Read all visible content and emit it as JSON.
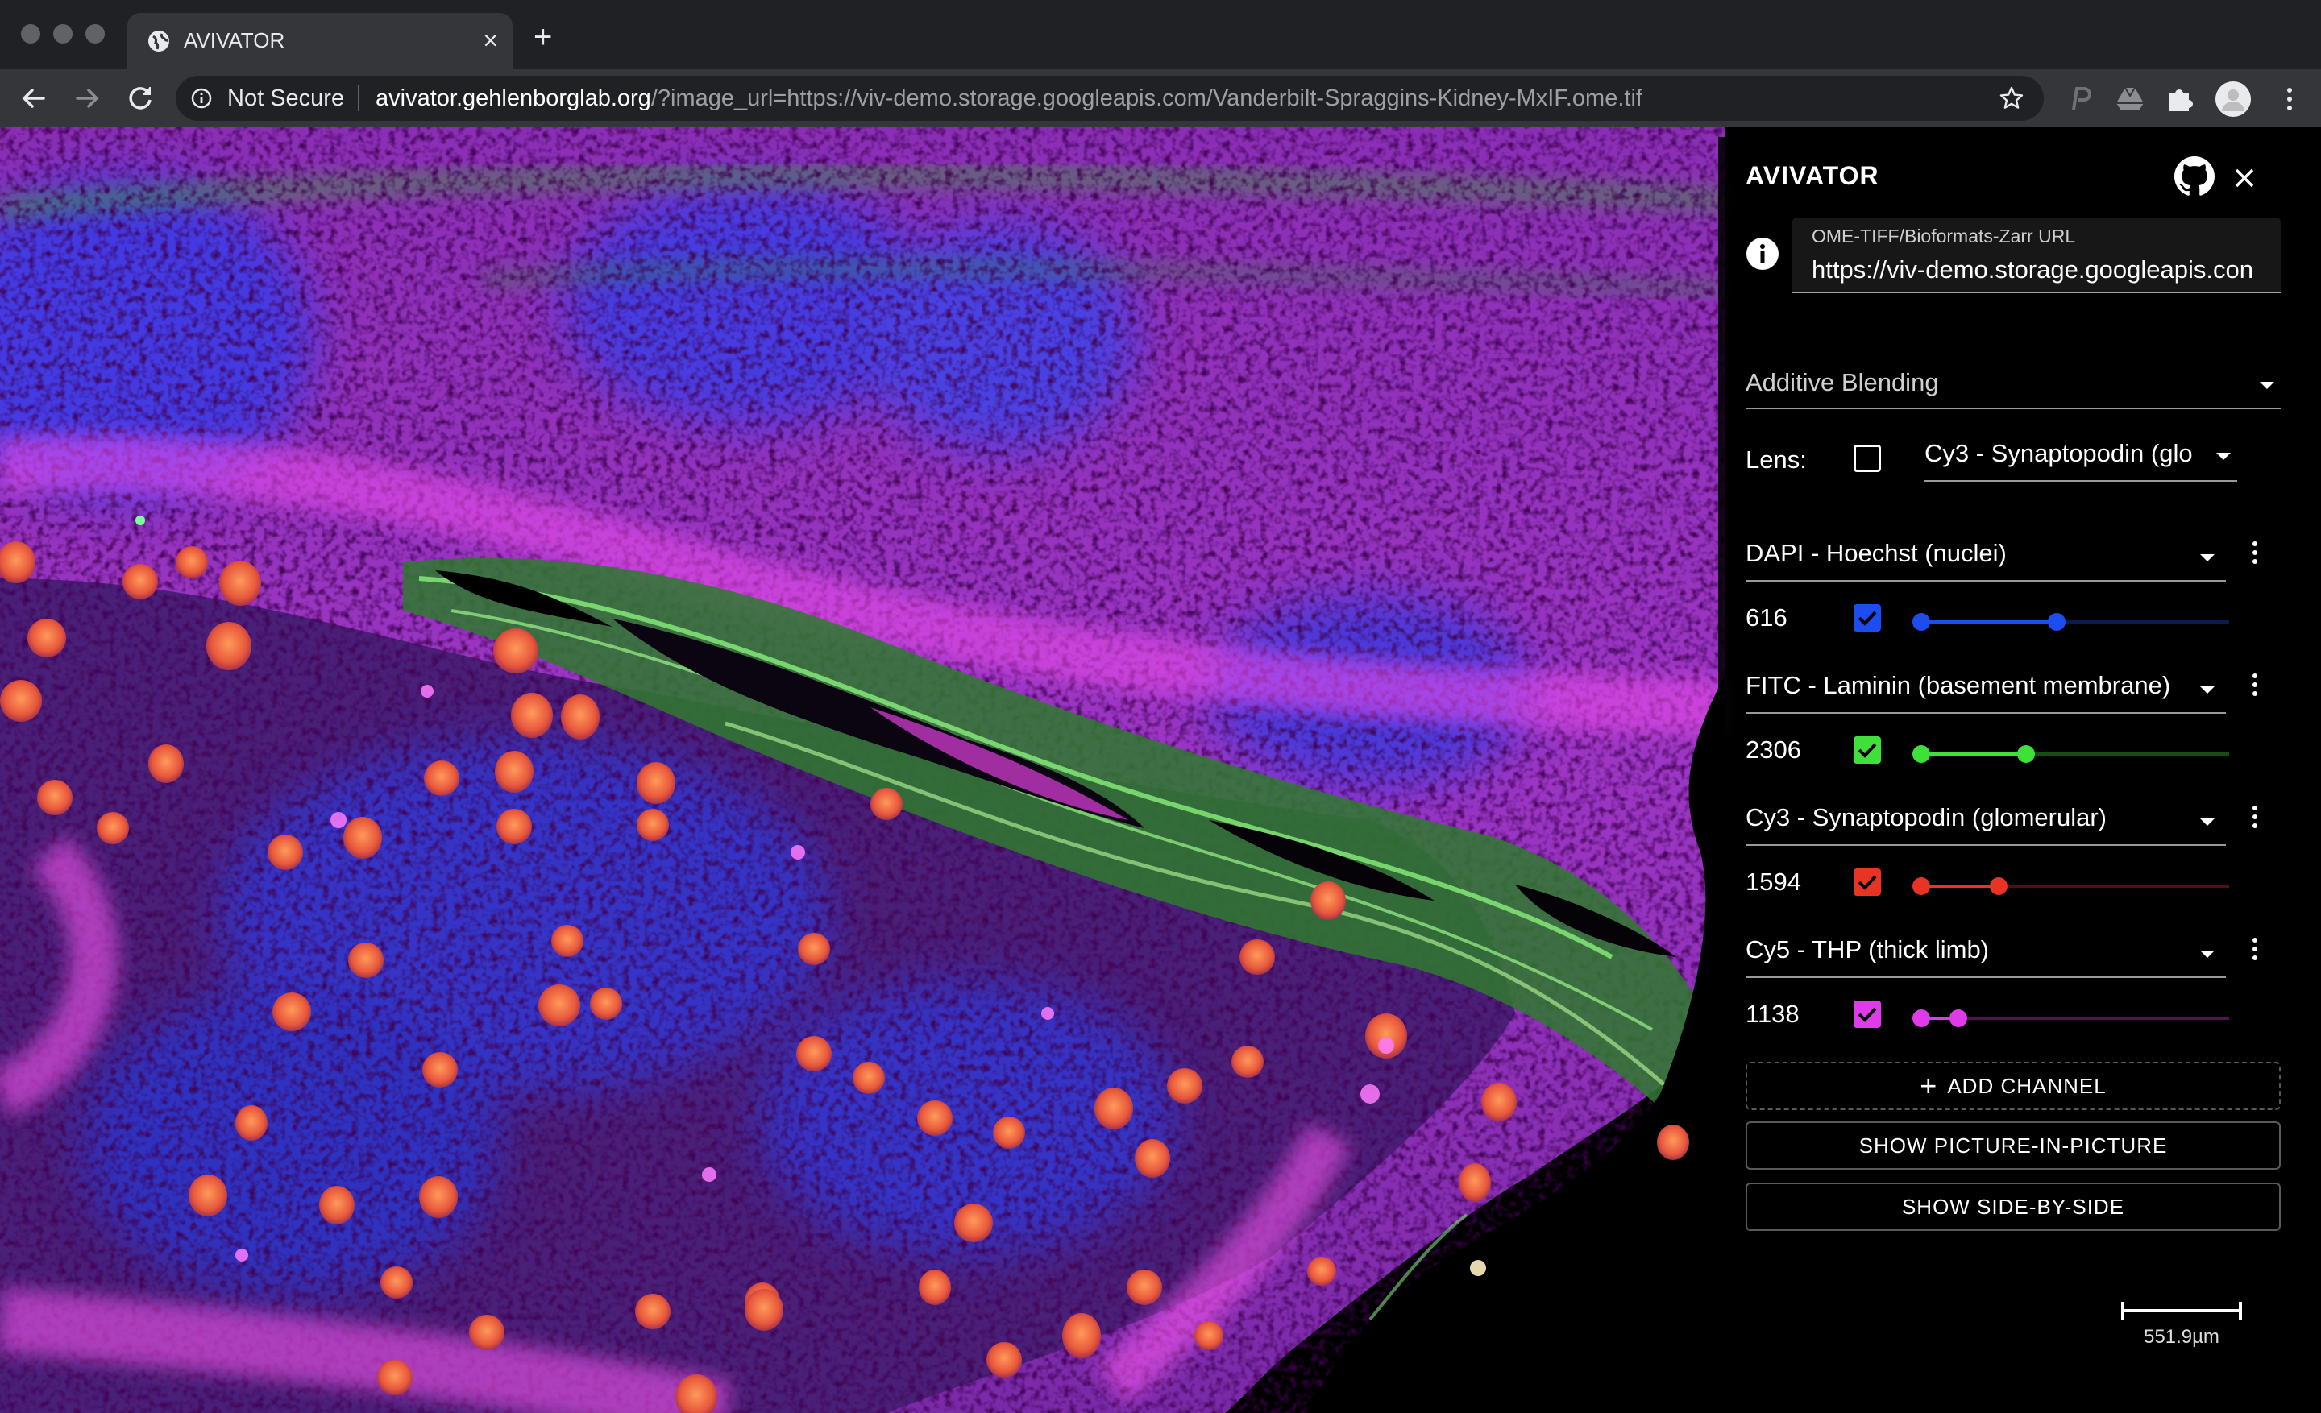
{
  "browser": {
    "tab_title": "AVIVATOR",
    "security_label": "Not Secure",
    "url_host": "avivator.gehlenborglab.org",
    "url_path": "/?image_url=https://viv-demo.storage.googleapis.com/Vanderbilt-Spraggins-Kidney-MxIF.ome.tif"
  },
  "panel": {
    "title": "AVIVATOR",
    "url_field": {
      "label": "OME-TIFF/Bioformats-Zarr URL",
      "value": "https://viv-demo.storage.googleapis.con"
    },
    "blending": {
      "selected": "Additive Blending"
    },
    "lens": {
      "label": "Lens:",
      "checked": false,
      "selected": "Cy3 - Synaptopodin (glo"
    },
    "channels": [
      {
        "name": "DAPI - Hoechst (nuclei)",
        "value": "616",
        "color": "#1d4cf0",
        "checked": true,
        "low": 0.0,
        "high": 0.44
      },
      {
        "name": "FITC - Laminin (basement membrane)",
        "value": "2306",
        "color": "#3ee03a",
        "checked": true,
        "low": 0.0,
        "high": 0.34
      },
      {
        "name": "Cy3 - Synaptopodin (glomerular)",
        "value": "1594",
        "color": "#e83325",
        "checked": true,
        "low": 0.0,
        "high": 0.25
      },
      {
        "name": "Cy5 - THP (thick limb)",
        "value": "1138",
        "color": "#e03be8",
        "checked": true,
        "low": 0.0,
        "high": 0.12
      }
    ],
    "add_channel_label": "ADD CHANNEL",
    "pip_label": "SHOW PICTURE-IN-PICTURE",
    "side_label": "SHOW SIDE-BY-SIDE"
  },
  "scale_bar": {
    "label": "551.9µm"
  },
  "icons": {
    "back": "arrow-left-icon",
    "forward": "arrow-right-icon",
    "reload": "reload-icon",
    "info": "info-icon",
    "star": "star-icon",
    "github": "github-icon",
    "close": "close-icon"
  }
}
